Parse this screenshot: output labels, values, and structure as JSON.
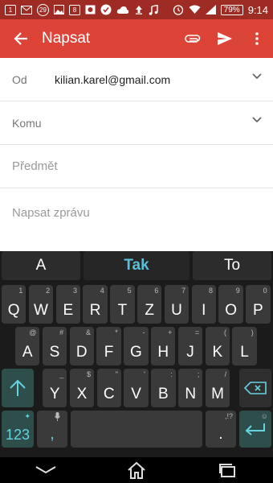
{
  "status_bar": {
    "icons": [
      "notification-1-icon",
      "mail-icon",
      "badge-29-icon",
      "image-icon",
      "badge-8-icon",
      "photo-icon",
      "check-icon",
      "cloud-icon",
      "upload-icon",
      "music-icon"
    ],
    "badge_1": "1",
    "badge_29": "29",
    "badge_8": "8",
    "battery": "79%",
    "time": "9:14"
  },
  "app_bar": {
    "title": "Napsat"
  },
  "compose": {
    "from_label": "Od",
    "from_value": "kilian.karel@gmail.com",
    "to_label": "Komu",
    "subject_placeholder": "Předmět",
    "body_placeholder": "Napsat zprávu"
  },
  "keyboard": {
    "suggestions": [
      "A",
      "Tak",
      "To"
    ],
    "row1": [
      {
        "k": "Q",
        "s": "1"
      },
      {
        "k": "W",
        "s": "2"
      },
      {
        "k": "E",
        "s": "3"
      },
      {
        "k": "R",
        "s": "4"
      },
      {
        "k": "T",
        "s": "5"
      },
      {
        "k": "Z",
        "s": "6"
      },
      {
        "k": "U",
        "s": "7"
      },
      {
        "k": "I",
        "s": "8"
      },
      {
        "k": "O",
        "s": "9"
      },
      {
        "k": "P",
        "s": "0"
      }
    ],
    "row2": [
      {
        "k": "A",
        "s": "@"
      },
      {
        "k": "S",
        "s": "#"
      },
      {
        "k": "D",
        "s": "&"
      },
      {
        "k": "F",
        "s": "*"
      },
      {
        "k": "G",
        "s": "-"
      },
      {
        "k": "H",
        "s": "+"
      },
      {
        "k": "J",
        "s": "="
      },
      {
        "k": "K",
        "s": "("
      },
      {
        "k": "L",
        "s": ")"
      }
    ],
    "row3": [
      {
        "k": "Y",
        "s": "_"
      },
      {
        "k": "X",
        "s": "$"
      },
      {
        "k": "C",
        "s": "\""
      },
      {
        "k": "V",
        "s": "'"
      },
      {
        "k": "B",
        "s": ":"
      },
      {
        "k": "N",
        "s": ";"
      },
      {
        "k": "M",
        "s": "/"
      }
    ],
    "num_label": "123",
    "comma": ",",
    "period": ".",
    "period_sub": ",!?",
    "accent_color": "#65d3e0"
  },
  "colors": {
    "app_bar": "#db4437",
    "status_bar": "#9e2c24",
    "suggestion_highlight": "#56c1d8"
  }
}
